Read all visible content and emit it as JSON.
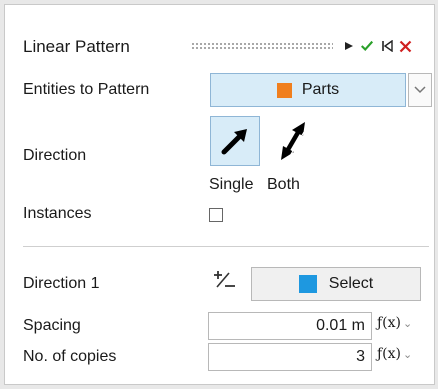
{
  "panel": {
    "title": "Linear Pattern",
    "actions": [
      {
        "name": "play-icon",
        "color": "#222222"
      },
      {
        "name": "check-icon",
        "color": "#2aa02a"
      },
      {
        "name": "reset-icon",
        "color": "#222222"
      },
      {
        "name": "close-icon",
        "color": "#d01f1f"
      }
    ]
  },
  "entities": {
    "label": "Entities to Pattern",
    "button_label": "Parts",
    "button_color": "#f07f1e"
  },
  "direction": {
    "label": "Direction",
    "options": [
      {
        "label": "Single",
        "selected": true
      },
      {
        "label": "Both",
        "selected": false
      }
    ]
  },
  "instances": {
    "label": "Instances",
    "checked": false
  },
  "direction1": {
    "label": "Direction 1",
    "select_label": "Select",
    "select_color": "#1e98e0"
  },
  "spacing": {
    "label": "Spacing",
    "value": "0.01 m",
    "fx_label": "ƒ(x)"
  },
  "copies": {
    "label": "No. of copies",
    "value": "3",
    "fx_label": "ƒ(x)"
  }
}
